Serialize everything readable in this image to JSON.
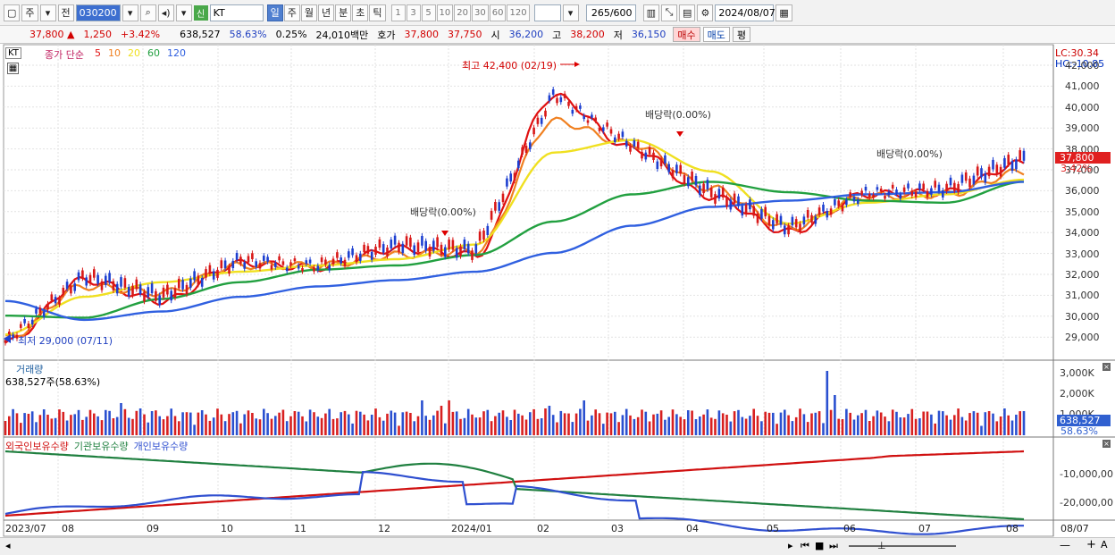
{
  "toolbar": {
    "market": "주",
    "period_toggle": "전",
    "code": "030200",
    "stock_badge": "신",
    "stock_name": "KT",
    "period_tabs": [
      "일",
      "주",
      "월",
      "년",
      "분",
      "초",
      "틱"
    ],
    "num_tabs": [
      "1",
      "3",
      "5",
      "10",
      "20",
      "30",
      "60",
      "120"
    ],
    "count_label": "265/600",
    "date": "2024/08/07"
  },
  "quote": {
    "price": "37,800 ▲",
    "change": "1,250",
    "change_pct": "+3.42%",
    "volume": "638,527",
    "turnover_pct": "58.63%",
    "ratio": "0.25%",
    "amount": "24,010백만",
    "ask_label": "호가",
    "ask": "37,800",
    "bid": "37,750",
    "open_label": "시",
    "open": "36,200",
    "high_label": "고",
    "high": "38,200",
    "low_label": "저",
    "low": "36,150",
    "buy_btn": "매수",
    "sell_btn": "매도",
    "eval_btn": "평"
  },
  "price_panel": {
    "stock_tag": "KT",
    "ma_title": "종가 단순",
    "ma_periods": [
      "5",
      "10",
      "20",
      "60",
      "120"
    ],
    "ma_colors": [
      "#e01010",
      "#f08020",
      "#f0e020",
      "#22a040",
      "#3060e0"
    ],
    "lc_label": "LC:30.34",
    "hc_label": "HC:-10.85",
    "high_annotation": "최고 42,400 (02/19)",
    "low_annotation": "최저 29,000 (07/11)",
    "dividend_labels": [
      "배당락(0.00%)",
      "배당락(0.00%)",
      "배당락(0.00%)"
    ],
    "y_ticks": [
      "42,000",
      "41,000",
      "40,000",
      "39,000",
      "38,000",
      "37,000",
      "36,000",
      "35,000",
      "34,000",
      "33,000",
      "32,000",
      "31,000",
      "30,000",
      "29,000"
    ],
    "current_price_tag": "37,800",
    "current_pct_tag": "3.42%"
  },
  "volume_panel": {
    "title": "거래량",
    "value_label": "638,527주(58.63%)",
    "y_ticks": [
      "3,000K",
      "2,000K",
      "1,000K"
    ],
    "current_tag": "638,527",
    "current_pct": "58.63%"
  },
  "holding_panel": {
    "legend": [
      "외국인보유수량",
      "기관보유수량",
      "개인보유수량"
    ],
    "legend_colors": [
      "#d01010",
      "#208040",
      "#3050d0"
    ],
    "y_ticks": [
      "-10,000,00",
      "-20,000,00"
    ]
  },
  "x_axis": {
    "labels": [
      "2023/07",
      "08",
      "09",
      "10",
      "11",
      "12",
      "2024/01",
      "02",
      "03",
      "04",
      "05",
      "06",
      "07",
      "08"
    ],
    "right_label": "08/07"
  },
  "chart_data": {
    "type": "line",
    "title": "KT",
    "x": [
      "2023/07",
      "2023/08",
      "2023/09",
      "2023/10",
      "2023/11",
      "2023/12",
      "2024/01",
      "2024/02",
      "2024/03",
      "2024/04",
      "2024/05",
      "2024/06",
      "2024/07",
      "2024/08"
    ],
    "series": [
      {
        "name": "5",
        "values": [
          29200,
          32200,
          31200,
          33000,
          32800,
          33700,
          33400,
          41000,
          38500,
          36200,
          34500,
          36300,
          36400,
          37800
        ]
      },
      {
        "name": "10",
        "values": [
          29400,
          31900,
          31600,
          32900,
          32900,
          33400,
          33600,
          39800,
          38700,
          36600,
          34700,
          36200,
          36300,
          37400
        ]
      },
      {
        "name": "20",
        "values": [
          29600,
          31400,
          32100,
          32600,
          32900,
          33200,
          33900,
          38300,
          38900,
          37400,
          34900,
          35900,
          36300,
          37000
        ]
      },
      {
        "name": "60",
        "values": [
          30500,
          30400,
          31300,
          32100,
          32700,
          32900,
          33400,
          35000,
          36300,
          36900,
          36400,
          36000,
          35900,
          36900
        ]
      },
      {
        "name": "120",
        "values": [
          31200,
          30300,
          30700,
          31400,
          31900,
          32200,
          32600,
          33500,
          34800,
          35700,
          36000,
          36300,
          36400,
          36900
        ]
      }
    ],
    "ylim": [
      28500,
      42600
    ],
    "ylabel": "",
    "xlabel": ""
  }
}
